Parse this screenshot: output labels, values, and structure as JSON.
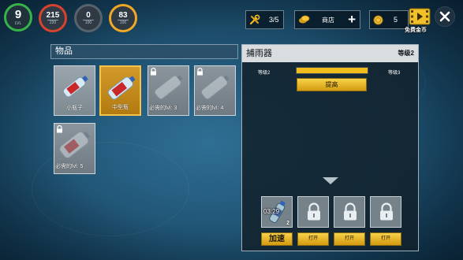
{
  "hud": {
    "level": {
      "value": "9",
      "label": "LVL"
    },
    "health": {
      "value": "215",
      "max": "220"
    },
    "water": {
      "value": "0",
      "max": "100"
    },
    "food": {
      "value": "83",
      "max": "100"
    },
    "tools": "3/5",
    "shop": {
      "label": "商店",
      "plus": "+"
    },
    "coins": "5",
    "free_coins_label": "免费金币"
  },
  "items_panel": {
    "title": "物品",
    "items": [
      {
        "name": "小瓶子",
        "state": "available"
      },
      {
        "name": "中型瓶",
        "state": "selected"
      },
      {
        "name": "必需的lvl: 3",
        "state": "locked"
      },
      {
        "name": "必需的lvl: 4",
        "state": "locked"
      },
      {
        "name": "必需的lvl: 5",
        "state": "locked"
      }
    ]
  },
  "catcher_panel": {
    "title": "捕雨器",
    "level_label": "等级2",
    "progress_from": "等级2",
    "progress_to": "等级3",
    "progress": 1.0,
    "upgrade_label": "提高",
    "slots": [
      {
        "state": "active",
        "timer": "03:29",
        "count": "2",
        "button": "加速"
      },
      {
        "state": "locked",
        "button": "打开"
      },
      {
        "state": "locked",
        "button": "打开"
      },
      {
        "state": "locked",
        "button": "打开"
      }
    ]
  },
  "colors": {
    "level_ring": "#37b34a",
    "health_ring": "#d9432e",
    "food_ring": "#f2a825",
    "accent_gold": "#f1bd1d",
    "background": "#235a7c"
  }
}
